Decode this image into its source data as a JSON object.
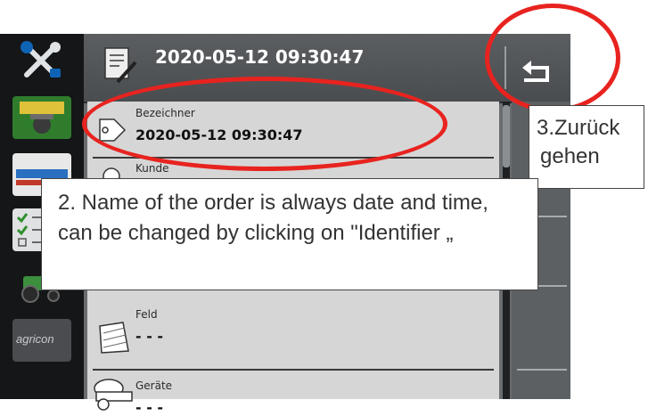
{
  "header": {
    "title": "2020-05-12 09:30:47",
    "back_icon": "back-arrow-icon"
  },
  "sidebar": {
    "items": [
      {
        "icon": "tools-icon"
      },
      {
        "icon": "tractor-gps-icon"
      },
      {
        "icon": "fhr-implement-icon"
      },
      {
        "icon": "checklist-icon"
      },
      {
        "icon": "tractor-icon"
      },
      {
        "icon": "agricon-logo-icon",
        "text": "agricon"
      }
    ]
  },
  "list": {
    "items": [
      {
        "label": "Bezeichner",
        "value": "2020-05-12 09:30:47",
        "icon": "tag-icon"
      },
      {
        "label": "Kunde",
        "value": "",
        "icon": "customer-icon"
      },
      {
        "label": "Feld",
        "value": "- - -",
        "icon": "field-icon"
      },
      {
        "label": "Geräte",
        "value": "- - -",
        "icon": "implement-icon"
      }
    ]
  },
  "annotations": {
    "identifier_note": "2. Name of the order is always date and time, can be changed by clicking on \"Identifier „",
    "back_note_line1": "3.Zurück",
    "back_note_line2": "gehen"
  },
  "colors": {
    "annotation_red": "#e8231f",
    "list_bg": "#d6d6d6",
    "header_bg": "#4f5255"
  }
}
